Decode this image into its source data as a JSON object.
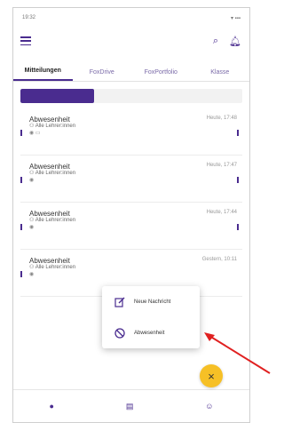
{
  "status": {
    "time": "19:32",
    "right": ""
  },
  "appbar": {
    "title": "",
    "subtitle": ""
  },
  "tabs": [
    {
      "label": "Mitteilungen"
    },
    {
      "label": "FoxDrive"
    },
    {
      "label": "FoxPortfolio"
    },
    {
      "label": "Klasse"
    }
  ],
  "segments": [
    {
      "label": ""
    },
    {
      "label": ""
    },
    {
      "label": ""
    }
  ],
  "messages": [
    {
      "title": "Abwesenheit",
      "time": "Heute, 17:48",
      "line": "Alle Lehrer:innen"
    },
    {
      "title": "Abwesenheit",
      "time": "Heute, 17:47",
      "line": "Alle Lehrer:innen"
    },
    {
      "title": "Abwesenheit",
      "time": "Heute, 17:44",
      "line": "Alle Lehrer:innen"
    },
    {
      "title": "Abwesenheit",
      "time": "Gestern, 10:11",
      "line": "Alle Lehrer:innen"
    }
  ],
  "popup": {
    "items": [
      {
        "label": "Neue Nachricht",
        "icon": "compose-icon"
      },
      {
        "label": "Abwesenheit",
        "icon": "block-icon"
      }
    ]
  },
  "fab": {
    "icon": "close-icon"
  },
  "colors": {
    "primary": "#4a2c8f",
    "fab": "#f6c026",
    "arrow": "#e02020"
  }
}
